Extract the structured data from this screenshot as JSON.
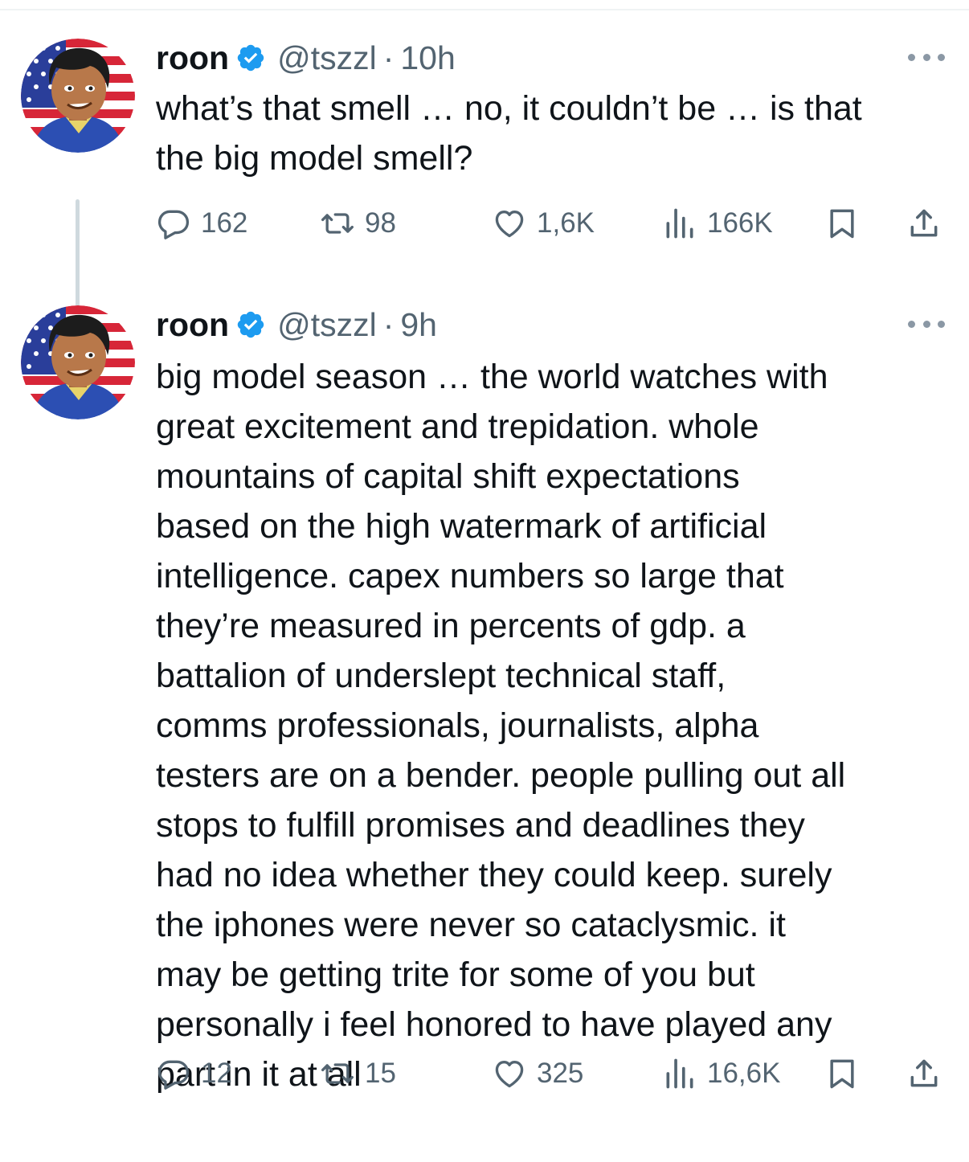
{
  "tweets": [
    {
      "author": {
        "name": "roon",
        "handle": "@tszzl",
        "verified": true,
        "avatar": "avatar-icon"
      },
      "separator": "·",
      "time": "10h",
      "text": "what’s that smell … no, it couldn’t be … is that\nthe big model smell?",
      "stats": {
        "replies": "162",
        "retweets": "98",
        "likes": "1,6K",
        "views": "166K"
      }
    },
    {
      "author": {
        "name": "roon",
        "handle": "@tszzl",
        "verified": true,
        "avatar": "avatar-icon"
      },
      "separator": "·",
      "time": "9h",
      "text": "big model season … the world watches with\ngreat excitement and trepidation. whole\nmountains of capital shift expectations\nbased on the high watermark of artificial\nintelligence. capex numbers so large that\nthey’re measured in percents of gdp. a\nbattalion of underslept technical staff,\ncomms professionals, journalists, alpha\ntesters are on a bender. people pulling out all\nstops to fulfill promises and deadlines they\nhad no idea whether they could keep. surely\nthe iphones were never so cataclysmic. it\nmay be getting trite for some of you but\npersonally i feel honored to have played any\npart in it at all",
      "stats": {
        "replies": "12",
        "retweets": "15",
        "likes": "325",
        "views": "16,6K"
      }
    }
  ],
  "icons": {
    "reply": "reply-icon",
    "retweet": "retweet-icon",
    "like": "heart-icon",
    "views": "views-icon",
    "bookmark": "bookmark-icon",
    "share": "share-icon",
    "more": "more-icon",
    "verified": "verified-badge-icon"
  },
  "colors": {
    "text": "#0f1419",
    "secondary": "#536471",
    "verified": "#1d9bf0",
    "thread_line": "#cfd9de"
  }
}
